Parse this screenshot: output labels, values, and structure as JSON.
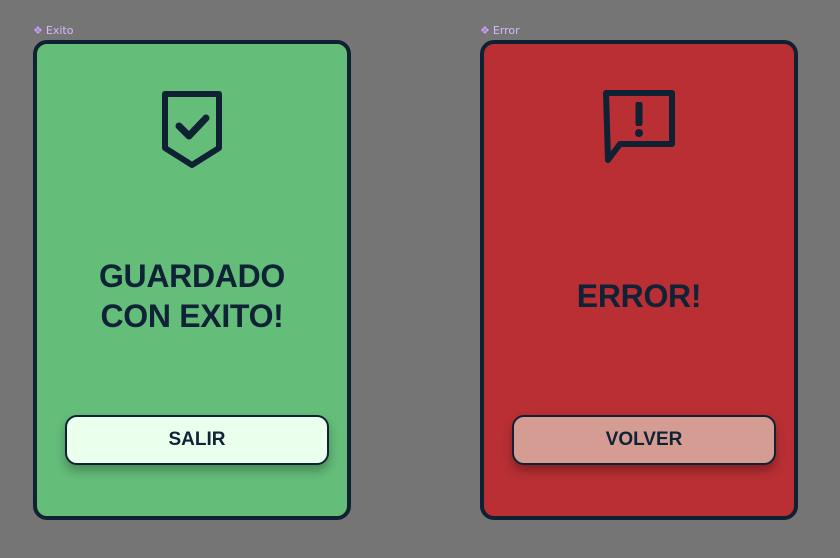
{
  "frames": {
    "success": {
      "label": "Exito",
      "icon": "shield-check-icon",
      "title_lines": [
        "GUARDADO",
        "CON EXITO!"
      ],
      "button_label": "SALIR",
      "colors": {
        "background": "#64bd79",
        "button": "#ebffed"
      }
    },
    "error": {
      "label": "Error",
      "icon": "alert-message-icon",
      "title_lines": [
        "ERROR!"
      ],
      "button_label": "VOLVER",
      "colors": {
        "background": "#b92f33",
        "button": "#d49c92"
      }
    }
  },
  "colors": {
    "canvas": "#757575",
    "ink": "#0f2133",
    "frame_label": "#d7b8ff"
  }
}
